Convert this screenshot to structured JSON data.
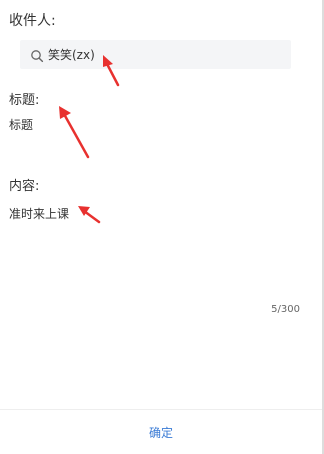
{
  "form": {
    "recipients_label": "收件人:",
    "recipient_value": "笑笑(zx)",
    "title_label": "标题:",
    "title_value": "标题",
    "content_label": "内容:",
    "content_value": "准时来上课",
    "char_count": "5/300"
  },
  "footer": {
    "confirm_label": "确定"
  },
  "colors": {
    "accent": "#3a7bd5",
    "annotation": "#e8312f",
    "search_bg": "#f4f5f7"
  },
  "icons": {
    "search": "search-icon"
  }
}
